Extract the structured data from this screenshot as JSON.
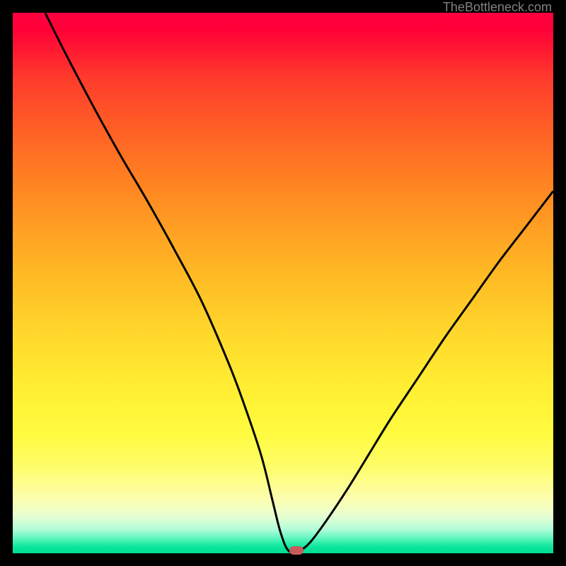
{
  "watermark": "TheBottleneck.com",
  "chart_data": {
    "type": "line",
    "xlim": [
      0,
      100
    ],
    "ylim": [
      0,
      100
    ],
    "title": "",
    "xlabel": "",
    "ylabel": "",
    "x": [
      6,
      10,
      15,
      20,
      25,
      30,
      35,
      40,
      43,
      46,
      48,
      49.5,
      51,
      53,
      55,
      58,
      62,
      66,
      70,
      75,
      80,
      85,
      90,
      95,
      100
    ],
    "values": [
      100,
      92,
      82.5,
      73.5,
      65,
      56,
      46.5,
      35,
      27,
      18,
      10,
      4,
      0.5,
      0.5,
      2,
      6,
      12,
      18.5,
      25,
      32.5,
      40,
      47,
      54,
      60.5,
      67
    ],
    "marker": {
      "x": 52.5,
      "y": 0.5
    },
    "gradient_stops": [
      {
        "pct": 0,
        "color": "#ff0040"
      },
      {
        "pct": 50,
        "color": "#ffc828"
      },
      {
        "pct": 85,
        "color": "#fffd6a"
      },
      {
        "pct": 100,
        "color": "#00e094"
      }
    ]
  }
}
